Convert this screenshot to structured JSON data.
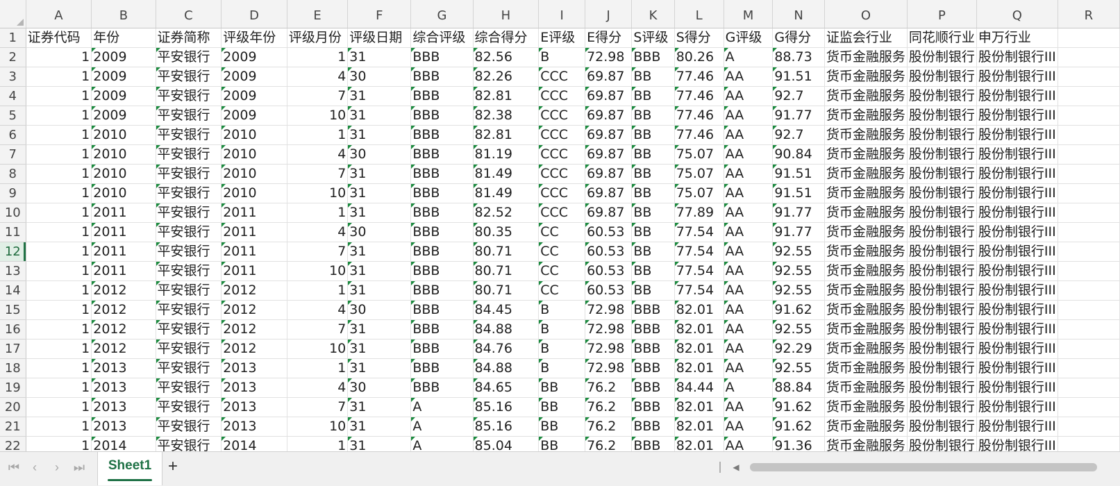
{
  "columns": [
    "A",
    "B",
    "C",
    "D",
    "E",
    "F",
    "G",
    "H",
    "I",
    "J",
    "K",
    "L",
    "M",
    "N",
    "O",
    "P",
    "Q",
    "R"
  ],
  "header_row": [
    "证券代码",
    "年份",
    "证券简称",
    "评级年份",
    "评级月份",
    "评级日期",
    "综合评级",
    "综合得分",
    "E评级",
    "E得分",
    "S评级",
    "S得分",
    "G评级",
    "G得分",
    "证监会行业",
    "同花顺行业",
    "申万行业",
    ""
  ],
  "rows": [
    [
      1,
      "2009",
      "平安银行",
      "2009",
      1,
      "31",
      "BBB",
      "82.56",
      "B",
      "72.98",
      "BBB",
      "80.26",
      "A",
      "88.73",
      "货币金融服务",
      "股份制银行",
      "股份制银行III"
    ],
    [
      1,
      "2009",
      "平安银行",
      "2009",
      4,
      "30",
      "BBB",
      "82.26",
      "CCC",
      "69.87",
      "BB",
      "77.46",
      "AA",
      "91.51",
      "货币金融服务",
      "股份制银行",
      "股份制银行III"
    ],
    [
      1,
      "2009",
      "平安银行",
      "2009",
      7,
      "31",
      "BBB",
      "82.81",
      "CCC",
      "69.87",
      "BB",
      "77.46",
      "AA",
      "92.7",
      "货币金融服务",
      "股份制银行",
      "股份制银行III"
    ],
    [
      1,
      "2009",
      "平安银行",
      "2009",
      10,
      "31",
      "BBB",
      "82.38",
      "CCC",
      "69.87",
      "BB",
      "77.46",
      "AA",
      "91.77",
      "货币金融服务",
      "股份制银行",
      "股份制银行III"
    ],
    [
      1,
      "2010",
      "平安银行",
      "2010",
      1,
      "31",
      "BBB",
      "82.81",
      "CCC",
      "69.87",
      "BB",
      "77.46",
      "AA",
      "92.7",
      "货币金融服务",
      "股份制银行",
      "股份制银行III"
    ],
    [
      1,
      "2010",
      "平安银行",
      "2010",
      4,
      "30",
      "BBB",
      "81.19",
      "CCC",
      "69.87",
      "BB",
      "75.07",
      "AA",
      "90.84",
      "货币金融服务",
      "股份制银行",
      "股份制银行III"
    ],
    [
      1,
      "2010",
      "平安银行",
      "2010",
      7,
      "31",
      "BBB",
      "81.49",
      "CCC",
      "69.87",
      "BB",
      "75.07",
      "AA",
      "91.51",
      "货币金融服务",
      "股份制银行",
      "股份制银行III"
    ],
    [
      1,
      "2010",
      "平安银行",
      "2010",
      10,
      "31",
      "BBB",
      "81.49",
      "CCC",
      "69.87",
      "BB",
      "75.07",
      "AA",
      "91.51",
      "货币金融服务",
      "股份制银行",
      "股份制银行III"
    ],
    [
      1,
      "2011",
      "平安银行",
      "2011",
      1,
      "31",
      "BBB",
      "82.52",
      "CCC",
      "69.87",
      "BB",
      "77.89",
      "AA",
      "91.77",
      "货币金融服务",
      "股份制银行",
      "股份制银行III"
    ],
    [
      1,
      "2011",
      "平安银行",
      "2011",
      4,
      "30",
      "BBB",
      "80.35",
      "CC",
      "60.53",
      "BB",
      "77.54",
      "AA",
      "91.77",
      "货币金融服务",
      "股份制银行",
      "股份制银行III"
    ],
    [
      1,
      "2011",
      "平安银行",
      "2011",
      7,
      "31",
      "BBB",
      "80.71",
      "CC",
      "60.53",
      "BB",
      "77.54",
      "AA",
      "92.55",
      "货币金融服务",
      "股份制银行",
      "股份制银行III"
    ],
    [
      1,
      "2011",
      "平安银行",
      "2011",
      10,
      "31",
      "BBB",
      "80.71",
      "CC",
      "60.53",
      "BB",
      "77.54",
      "AA",
      "92.55",
      "货币金融服务",
      "股份制银行",
      "股份制银行III"
    ],
    [
      1,
      "2012",
      "平安银行",
      "2012",
      1,
      "31",
      "BBB",
      "80.71",
      "CC",
      "60.53",
      "BB",
      "77.54",
      "AA",
      "92.55",
      "货币金融服务",
      "股份制银行",
      "股份制银行III"
    ],
    [
      1,
      "2012",
      "平安银行",
      "2012",
      4,
      "30",
      "BBB",
      "84.45",
      "B",
      "72.98",
      "BBB",
      "82.01",
      "AA",
      "91.62",
      "货币金融服务",
      "股份制银行",
      "股份制银行III"
    ],
    [
      1,
      "2012",
      "平安银行",
      "2012",
      7,
      "31",
      "BBB",
      "84.88",
      "B",
      "72.98",
      "BBB",
      "82.01",
      "AA",
      "92.55",
      "货币金融服务",
      "股份制银行",
      "股份制银行III"
    ],
    [
      1,
      "2012",
      "平安银行",
      "2012",
      10,
      "31",
      "BBB",
      "84.76",
      "B",
      "72.98",
      "BBB",
      "82.01",
      "AA",
      "92.29",
      "货币金融服务",
      "股份制银行",
      "股份制银行III"
    ],
    [
      1,
      "2013",
      "平安银行",
      "2013",
      1,
      "31",
      "BBB",
      "84.88",
      "B",
      "72.98",
      "BBB",
      "82.01",
      "AA",
      "92.55",
      "货币金融服务",
      "股份制银行",
      "股份制银行III"
    ],
    [
      1,
      "2013",
      "平安银行",
      "2013",
      4,
      "30",
      "BBB",
      "84.65",
      "BB",
      "76.2",
      "BBB",
      "84.44",
      "A",
      "88.84",
      "货币金融服务",
      "股份制银行",
      "股份制银行III"
    ],
    [
      1,
      "2013",
      "平安银行",
      "2013",
      7,
      "31",
      "A",
      "85.16",
      "BB",
      "76.2",
      "BBB",
      "82.01",
      "AA",
      "91.62",
      "货币金融服务",
      "股份制银行",
      "股份制银行III"
    ],
    [
      1,
      "2013",
      "平安银行",
      "2013",
      10,
      "31",
      "A",
      "85.16",
      "BB",
      "76.2",
      "BBB",
      "82.01",
      "AA",
      "91.62",
      "货币金融服务",
      "股份制银行",
      "股份制银行III"
    ],
    [
      1,
      "2014",
      "平安银行",
      "2014",
      1,
      "31",
      "A",
      "85.04",
      "BB",
      "76.2",
      "BBB",
      "82.01",
      "AA",
      "91.36",
      "货币金融服务",
      "股份制银行",
      "股份制银行III"
    ]
  ],
  "active_row": 12,
  "tabbar": {
    "sheet_tab": "Sheet1",
    "add_sheet": "+",
    "nav_first": "|<",
    "nav_prev": "<",
    "nav_next": ">",
    "nav_last": ">|"
  },
  "colors": {
    "accent": "#217346",
    "tab_text": "#1e7145",
    "error_triangle": "#1b8a3e"
  }
}
